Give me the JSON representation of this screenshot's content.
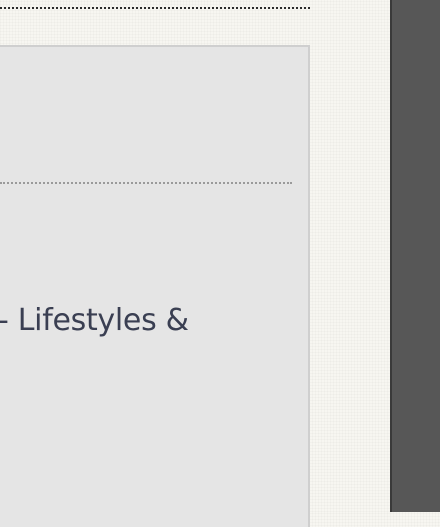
{
  "panel": {
    "text": "- Lifestyles &"
  },
  "colors": {
    "page_background": "#f7f6f1",
    "panel_background": "#e5e5e5",
    "frame": "#575757",
    "text": "#3a3f52"
  }
}
